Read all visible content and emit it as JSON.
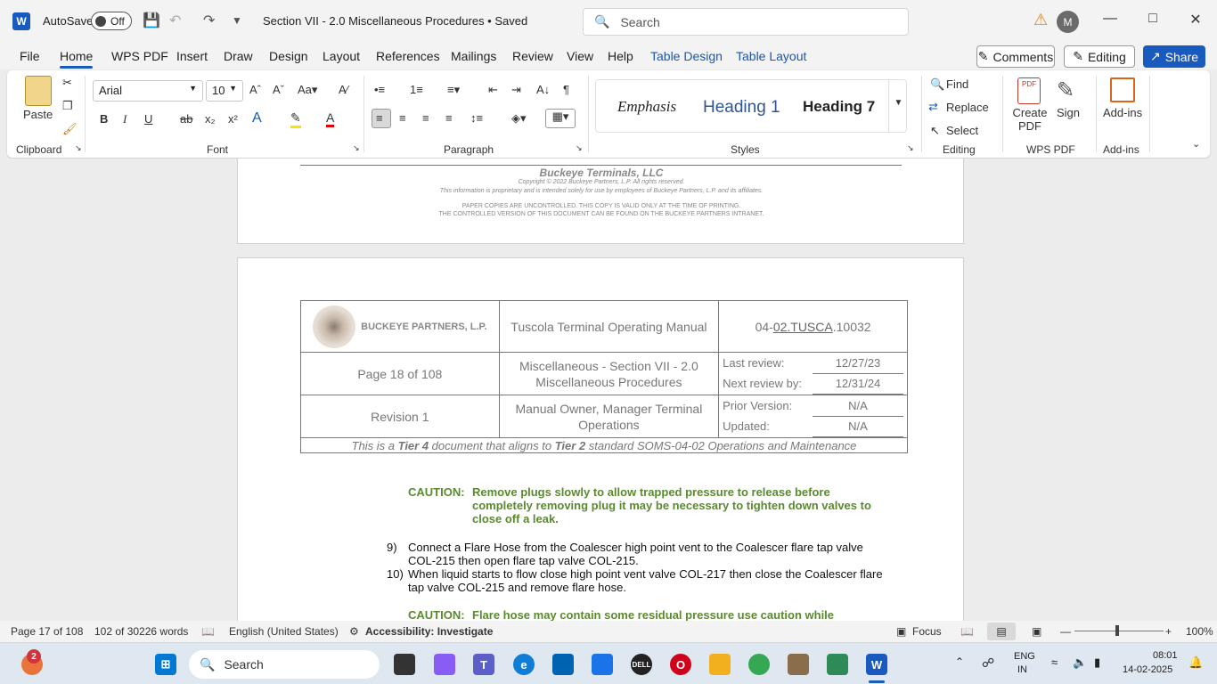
{
  "titlebar": {
    "autosave_label": "AutoSave",
    "toggle_state": "Off",
    "doc_title": "Section VII - 2.0 Miscellaneous Procedures • Saved",
    "search_placeholder": "Search",
    "avatar_initial": "M"
  },
  "tabs": [
    "File",
    "Home",
    "WPS PDF",
    "Insert",
    "Draw",
    "Design",
    "Layout",
    "References",
    "Mailings",
    "Review",
    "View",
    "Help",
    "Table Design",
    "Table Layout"
  ],
  "actions": {
    "comments": "Comments",
    "editing": "Editing",
    "share": "Share"
  },
  "ribbon": {
    "paste": "Paste",
    "font_name": "Arial",
    "font_size": "10",
    "styles": [
      "Emphasis",
      "Heading 1",
      "Heading 7"
    ],
    "find": "Find",
    "replace": "Replace",
    "select": "Select",
    "create_pdf": "Create PDF",
    "sign": "Sign",
    "addins": "Add-ins",
    "groups": [
      "Clipboard",
      "Font",
      "Paragraph",
      "Styles",
      "Editing",
      "WPS PDF",
      "Add-ins"
    ]
  },
  "footer": {
    "company": "Buckeye Terminals, LLC",
    "copyright": "Copyright © 2022 Buckeye Partners, L.P. All rights reserved.",
    "proprietary": "This information is proprietary and is intended solely for use by employees of Buckeye Partners, L.P. and its affiliates.",
    "paper1": "PAPER COPIES ARE UNCONTROLLED. THIS COPY IS VALID ONLY AT THE TIME OF PRINTING.",
    "paper2": "THE CONTROLLED VERSION OF THIS DOCUMENT CAN BE FOUND ON THE BUCKEYE PARTNERS INTRANET."
  },
  "header_table": {
    "logo_text": "BUCKEYE PARTNERS, L.P.",
    "manual": "Tuscola Terminal Operating Manual",
    "doc_id_prefix": "04-",
    "doc_id_link": "02.TUSCA",
    "doc_id_suffix": ".10032",
    "page": "Page 18 of 108",
    "section": "Miscellaneous - Section VII - 2.0 Miscellaneous Procedures",
    "revision": "Revision 1",
    "owner": "Manual Owner, Manager Terminal Operations",
    "last_review_label": "Last review:",
    "last_review": "12/27/23",
    "next_review_label": "Next review by:",
    "next_review": "12/31/24",
    "prior_label": "Prior Version:",
    "prior": "N/A",
    "updated_label": "Updated:",
    "updated": "N/A",
    "tier_pre": "This is a ",
    "tier4": "Tier 4",
    "tier_mid": " document that aligns to ",
    "tier2": "Tier 2",
    "tier_post": " standard SOMS-04-02 Operations and Maintenance"
  },
  "body": {
    "caution_label": "CAUTION:",
    "caution1_l1": "Remove plugs slowly to allow trapped pressure to release before",
    "caution1_l2": "completely removing plug it may be necessary to tighten down valves to",
    "caution1_l3": "close off a leak.",
    "step9_num": "9)",
    "step9_l1": "Connect a Flare Hose from the Coalescer high point vent to the Coalescer flare tap valve",
    "step9_l2": "COL-215 then open flare tap valve COL-215.",
    "step10_num": "10)",
    "step10_l1": "When liquid starts to flow close high point vent valve COL-217 then close the Coalescer flare",
    "step10_l2": "tap valve COL-215 and remove flare hose.",
    "caution2": "Flare hose may contain some residual pressure use caution while"
  },
  "status": {
    "page": "Page 17 of 108",
    "words": "102 of 30226 words",
    "language": "English (United States)",
    "accessibility": "Accessibility: Investigate",
    "focus": "Focus",
    "zoom": "100%"
  },
  "taskbar": {
    "search": "Search",
    "notif_count": "2",
    "lang1": "ENG",
    "lang2": "IN",
    "time": "08:01",
    "date": "14-02-2025"
  },
  "colors": {
    "accent": "#185abd",
    "caution": "#5a8a2e"
  }
}
